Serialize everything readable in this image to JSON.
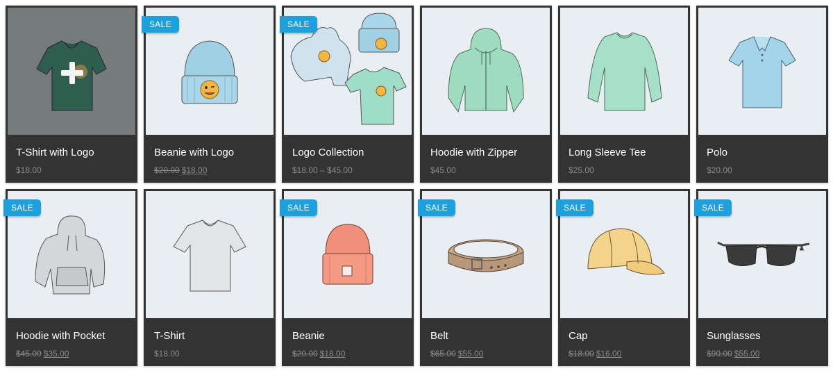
{
  "products": [
    {
      "title": "T-Shirt with Logo",
      "price": "$18.00",
      "old_price": "",
      "new_price": "",
      "sale": "",
      "image_icon": "tshirt-logo-icon"
    },
    {
      "title": "Beanie with Logo",
      "price": "",
      "old_price": "$20.00",
      "new_price": "$18.00",
      "sale": "SALE",
      "image_icon": "beanie-logo-icon"
    },
    {
      "title": "Logo Collection",
      "price": "$18.00 – $45.00",
      "old_price": "",
      "new_price": "",
      "sale": "SALE",
      "image_icon": "logo-collection-icon"
    },
    {
      "title": "Hoodie with Zipper",
      "price": "$45.00",
      "old_price": "",
      "new_price": "",
      "sale": "",
      "image_icon": "hoodie-zipper-icon"
    },
    {
      "title": "Long Sleeve Tee",
      "price": "$25.00",
      "old_price": "",
      "new_price": "",
      "sale": "",
      "image_icon": "long-sleeve-tee-icon"
    },
    {
      "title": "Polo",
      "price": "$20.00",
      "old_price": "",
      "new_price": "",
      "sale": "",
      "image_icon": "polo-icon"
    },
    {
      "title": "Hoodie with Pocket",
      "price": "",
      "old_price": "$45.00",
      "new_price": "$35.00",
      "sale": "SALE",
      "image_icon": "hoodie-pocket-icon"
    },
    {
      "title": "T-Shirt",
      "price": "$18.00",
      "old_price": "",
      "new_price": "",
      "sale": "",
      "image_icon": "tshirt-icon"
    },
    {
      "title": "Beanie",
      "price": "",
      "old_price": "$20.00",
      "new_price": "$18.00",
      "sale": "SALE",
      "image_icon": "beanie-icon"
    },
    {
      "title": "Belt",
      "price": "",
      "old_price": "$65.00",
      "new_price": "$55.00",
      "sale": "SALE",
      "image_icon": "belt-icon"
    },
    {
      "title": "Cap",
      "price": "",
      "old_price": "$18.00",
      "new_price": "$16.00",
      "sale": "SALE",
      "image_icon": "cap-icon"
    },
    {
      "title": "Sunglasses",
      "price": "",
      "old_price": "$90.00",
      "new_price": "$55.00",
      "sale": "SALE",
      "image_icon": "sunglasses-icon"
    }
  ],
  "colors": {
    "card_bg": "#333333",
    "image_bg": "#e9eef3",
    "hover_overlay": "#757a7b",
    "sale_badge": "#1ea0dc",
    "title_text": "#ffffff",
    "price_text": "#8a8a8a"
  }
}
